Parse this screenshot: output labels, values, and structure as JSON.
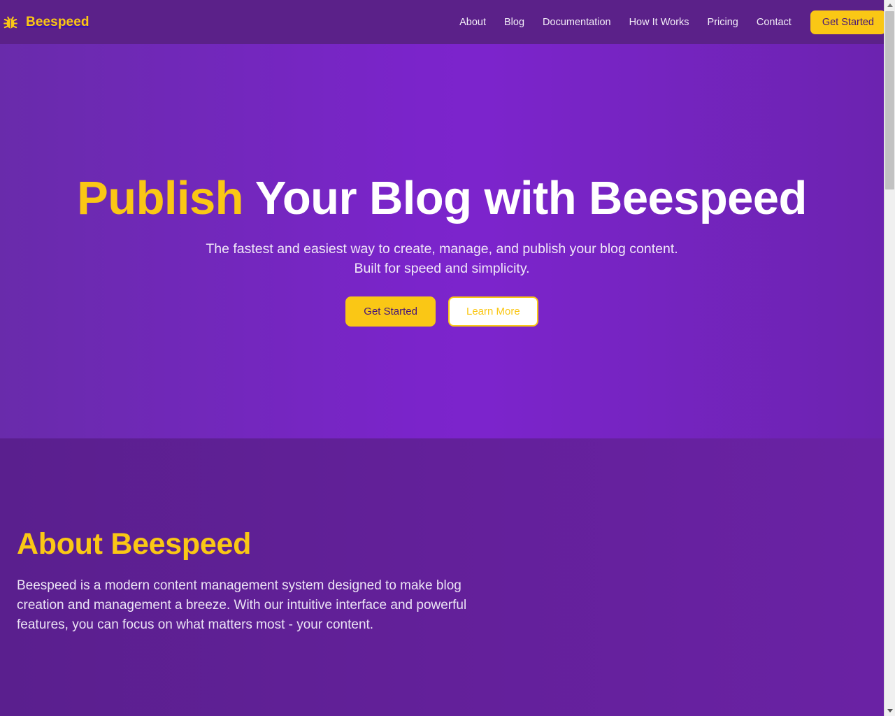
{
  "colors": {
    "brand_yellow": "#fac715",
    "header_purple": "#5b2189",
    "hero_purple_center": "#7b24cb",
    "hero_purple_edge": "#692bab",
    "about_purple": "#5a1f8e",
    "text_white": "#ffffff",
    "cta_text_purple": "#45147a"
  },
  "header": {
    "logo_icon": "bug-icon",
    "brand_name": "Beespeed",
    "nav_items": [
      {
        "label": "About"
      },
      {
        "label": "Blog"
      },
      {
        "label": "Documentation"
      },
      {
        "label": "How It Works"
      },
      {
        "label": "Pricing"
      },
      {
        "label": "Contact"
      }
    ],
    "cta_label": "Get Started"
  },
  "hero": {
    "title_accent": "Publish",
    "title_rest": " Your Blog with Beespeed",
    "subtitle": "The fastest and easiest way to create, manage, and publish your blog content. Built for speed and simplicity.",
    "primary_button": "Get Started",
    "secondary_button": "Learn More"
  },
  "about": {
    "title": "About Beespeed",
    "body": "Beespeed is a modern content management system designed to make blog creation and management a breeze. With our intuitive interface and powerful features, you can focus on what matters most - your content."
  },
  "scrollbar": {
    "up_arrow_icon": "triangle-up-icon",
    "down_arrow_icon": "triangle-down-icon"
  }
}
